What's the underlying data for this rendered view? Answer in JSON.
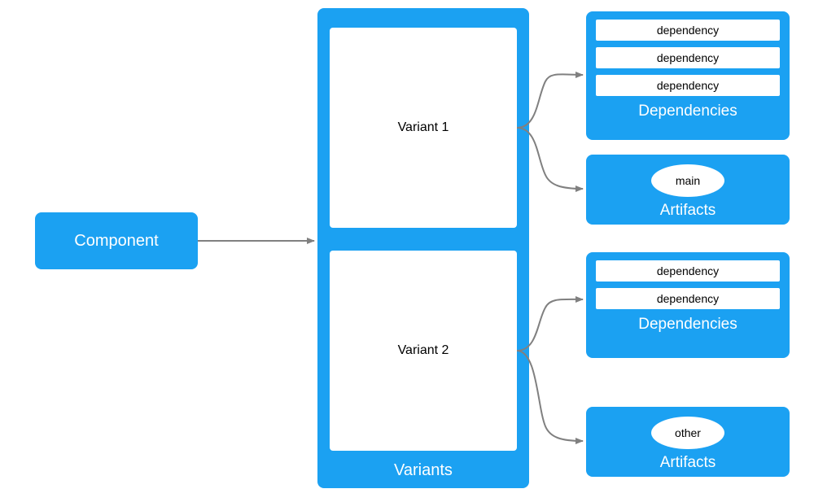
{
  "component": {
    "label": "Component"
  },
  "variants": {
    "label": "Variants",
    "items": [
      {
        "label": "Variant 1"
      },
      {
        "label": "Variant 2"
      }
    ]
  },
  "panels": {
    "deps1": {
      "label": "Dependencies",
      "items": [
        "dependency",
        "dependency",
        "dependency"
      ]
    },
    "arts1": {
      "label": "Artifacts",
      "items": [
        "main"
      ]
    },
    "deps2": {
      "label": "Dependencies",
      "items": [
        "dependency",
        "dependency"
      ]
    },
    "arts2": {
      "label": "Artifacts",
      "items": [
        "other"
      ]
    }
  },
  "colors": {
    "accent": "#1ba1f2",
    "arrow": "#808080"
  }
}
